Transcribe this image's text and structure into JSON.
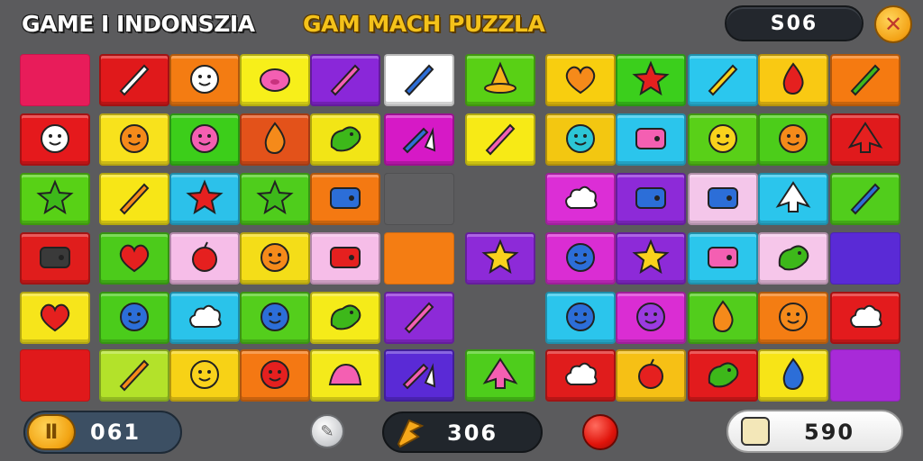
{
  "header": {
    "app_title": "GAME I INDONSZIA",
    "game_title": "GAM MACH PUZZLA",
    "top_counter": "S06"
  },
  "footer": {
    "score": "061",
    "bolts": "306",
    "coins": "590"
  },
  "icons": {
    "close": "close-icon",
    "score_badge": "trophy-icon",
    "hint": "hint-icon",
    "bolt": "lightning-bolt-icon",
    "red": "red-ball-icon",
    "coins": "ticket-icon"
  },
  "board": {
    "columns": 12,
    "rows": 6,
    "tiles": [
      {
        "color": "#e81c5a",
        "icon": "empty"
      },
      {
        "color": "#e0191b",
        "icon": "leaf"
      },
      {
        "color": "#f47c12",
        "icon": "face-white"
      },
      {
        "color": "#f7ef1a",
        "icon": "pig-pink"
      },
      {
        "color": "#8a27d9",
        "icon": "stick-pink"
      },
      {
        "color": "#ffffff",
        "icon": "pencil-blue"
      },
      {
        "color": "#59d015",
        "icon": "witch-hat"
      },
      {
        "color": "#f8ce0f",
        "icon": "heart-orange"
      },
      {
        "color": "#3bcf1c",
        "icon": "star-red"
      },
      {
        "color": "#2bc7ee",
        "icon": "carrot-yellow"
      },
      {
        "color": "#f9c913",
        "icon": "flame-red"
      },
      {
        "color": "#f57a11",
        "icon": "leaf-green"
      },
      {
        "color": "#e5191c",
        "icon": "face-white"
      },
      {
        "color": "#f8e21c",
        "icon": "face-orange"
      },
      {
        "color": "#3cce1a",
        "icon": "face-pink"
      },
      {
        "color": "#e3521a",
        "icon": "drop-orange"
      },
      {
        "color": "#f2e516",
        "icon": "dino-green"
      },
      {
        "color": "#d619c6",
        "icon": "pencils-blue"
      },
      {
        "color": "#f7ea16",
        "icon": "crayon-pink"
      },
      {
        "color": "#f3c711",
        "icon": "face-teal"
      },
      {
        "color": "#2bc5ec",
        "icon": "box-pink"
      },
      {
        "color": "#59d018",
        "icon": "face-yellow"
      },
      {
        "color": "#4ccd1a",
        "icon": "face-orange"
      },
      {
        "color": "#e01a1c",
        "icon": "arrow-red"
      },
      {
        "color": "#58d116",
        "icon": "star-green"
      },
      {
        "color": "#f7e617",
        "icon": "carrot-orange"
      },
      {
        "color": "#2cc1ea",
        "icon": "star-red"
      },
      {
        "color": "#4fcd1c",
        "icon": "star-green"
      },
      {
        "color": "#f47912",
        "icon": "toaster-blue"
      },
      {
        "color": "#5f5f61",
        "icon": "empty"
      },
      {
        "color": "#5b5b5d",
        "icon": "none"
      },
      {
        "color": "#dc2ed6",
        "icon": "cloud-white"
      },
      {
        "color": "#8d2ad8",
        "icon": "robot-blue"
      },
      {
        "color": "#f4c6ea",
        "icon": "camera-blue"
      },
      {
        "color": "#2bc5ec",
        "icon": "arrow-white"
      },
      {
        "color": "#51cd1c",
        "icon": "crayon-blue"
      },
      {
        "color": "#e01d1c",
        "icon": "tv-dark"
      },
      {
        "color": "#4ccb1b",
        "icon": "heart-red"
      },
      {
        "color": "#f6bde8",
        "icon": "apple-red"
      },
      {
        "color": "#f4dd18",
        "icon": "face-orange"
      },
      {
        "color": "#f6bde8",
        "icon": "toaster-red"
      },
      {
        "color": "#f47d13",
        "icon": "empty"
      },
      {
        "color": "#8d2ad8",
        "icon": "star-yellow"
      },
      {
        "color": "#da2dd3",
        "icon": "face-blue"
      },
      {
        "color": "#8d2ad8",
        "icon": "star-yellow"
      },
      {
        "color": "#2bc6ec",
        "icon": "sled-pink"
      },
      {
        "color": "#f6c6ea",
        "icon": "blob-green"
      },
      {
        "color": "#5a2ad6",
        "icon": "empty"
      },
      {
        "color": "#f6e51b",
        "icon": "heart-red"
      },
      {
        "color": "#4bcc1b",
        "icon": "face-blue"
      },
      {
        "color": "#2ac3ea",
        "icon": "cloud-white"
      },
      {
        "color": "#54ce1c",
        "icon": "face-blue"
      },
      {
        "color": "#f5eb19",
        "icon": "bird-green"
      },
      {
        "color": "#8d2ad8",
        "icon": "stick-pink"
      },
      {
        "color": "#5b5b5d",
        "icon": "none"
      },
      {
        "color": "#2bc5ec",
        "icon": "face-blue"
      },
      {
        "color": "#da2dd3",
        "icon": "face-purple"
      },
      {
        "color": "#52cd1c",
        "icon": "drop-orange"
      },
      {
        "color": "#f47d13",
        "icon": "face-orange"
      },
      {
        "color": "#e31b1d",
        "icon": "balls-white"
      },
      {
        "color": "#e0191b",
        "icon": "empty"
      },
      {
        "color": "#b3e22a",
        "icon": "carrot-orange"
      },
      {
        "color": "#f7d216",
        "icon": "face-yellow"
      },
      {
        "color": "#f47813",
        "icon": "face-red"
      },
      {
        "color": "#f4ea1b",
        "icon": "shell-pink"
      },
      {
        "color": "#5a2ad6",
        "icon": "pencils-pink"
      },
      {
        "color": "#4ecd1c",
        "icon": "arrow-pink"
      },
      {
        "color": "#e01c1c",
        "icon": "cloud-white"
      },
      {
        "color": "#f6c015",
        "icon": "apple-red"
      },
      {
        "color": "#e21b1d",
        "icon": "bird-green"
      },
      {
        "color": "#f7e417",
        "icon": "flame-blue"
      },
      {
        "color": "#a82ad8",
        "icon": "empty"
      }
    ]
  }
}
